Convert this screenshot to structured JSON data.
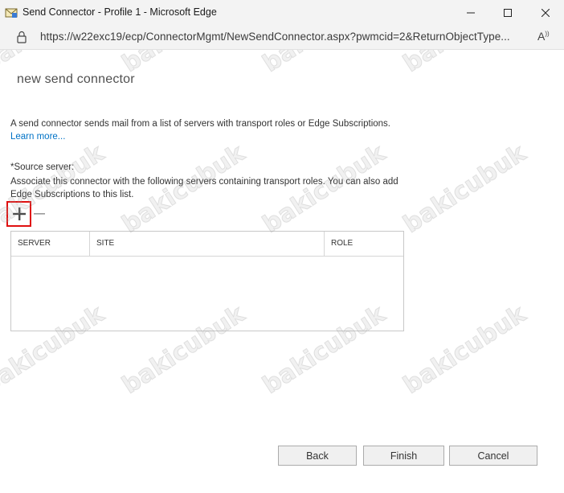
{
  "window": {
    "title": "Send Connector - Profile 1 - Microsoft Edge",
    "url": "https://w22exc19/ecp/ConnectorMgmt/NewSendConnector.aspx?pwmcid=2&ReturnObjectType..."
  },
  "page": {
    "title": "new send connector",
    "description": "A send connector sends mail from a list of servers with transport roles or Edge Subscriptions.",
    "learn_more": "Learn more..."
  },
  "source_server": {
    "label": "*Source server:",
    "help": "Associate this connector with the following servers containing transport roles. You can also add Edge Subscriptions to this list.",
    "add_icon": "plus-icon",
    "remove_icon": "minus-icon",
    "columns": [
      "SERVER",
      "SITE",
      "ROLE"
    ],
    "rows": []
  },
  "buttons": {
    "back": "Back",
    "finish": "Finish",
    "cancel": "Cancel"
  },
  "watermark": "bakicubuk",
  "colors": {
    "link": "#0072c6",
    "highlight": "#e01010",
    "titlebar": "#f3f3f3"
  }
}
